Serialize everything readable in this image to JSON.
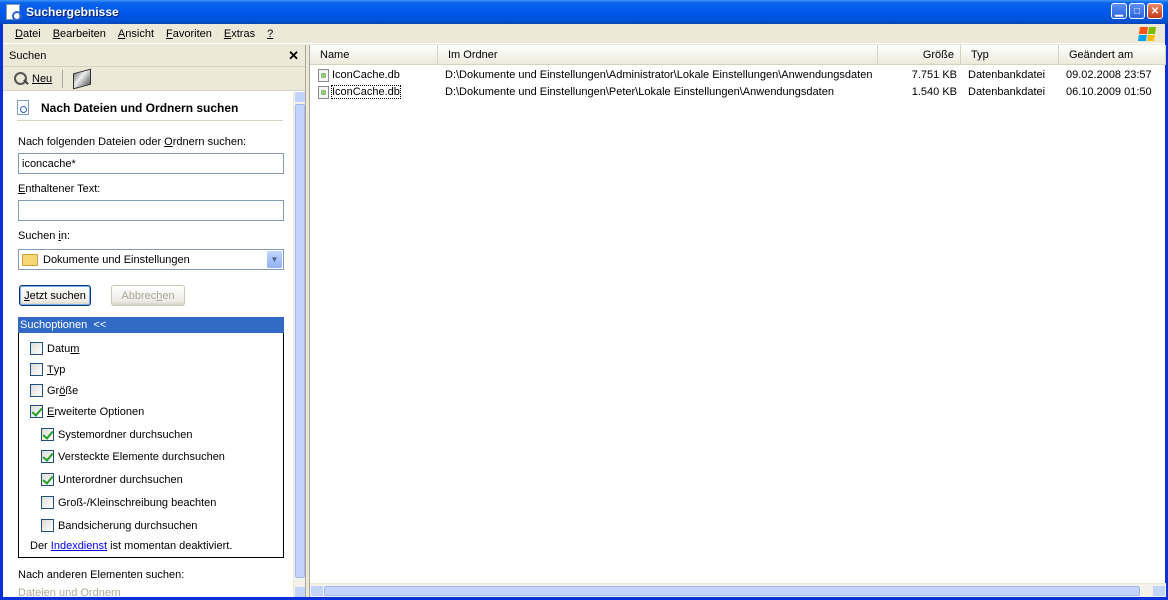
{
  "window": {
    "title": "Suchergebnisse",
    "controls": [
      "minimize",
      "maximize",
      "close"
    ]
  },
  "menu": {
    "items": [
      {
        "pre": "",
        "key": "D",
        "post": "atei"
      },
      {
        "pre": "",
        "key": "B",
        "post": "earbeiten"
      },
      {
        "pre": "",
        "key": "A",
        "post": "nsicht"
      },
      {
        "pre": "",
        "key": "F",
        "post": "avoriten"
      },
      {
        "pre": "",
        "key": "E",
        "post": "xtras"
      },
      {
        "pre": "",
        "key": "?",
        "post": ""
      }
    ]
  },
  "search_pane": {
    "header": "Suchen",
    "close_glyph": "✕",
    "toolbar": {
      "new_label": "Neu"
    },
    "section_title": "Nach Dateien und Ordnern suchen",
    "filename_label": {
      "pre": "Nach folgenden Dateien oder ",
      "key": "O",
      "post": "rdnern suchen:"
    },
    "filename_value": "iconcache*",
    "contains_label": {
      "pre": "",
      "key": "E",
      "post": "nthaltener Text:"
    },
    "contains_value": "",
    "look_in_label": {
      "pre": "Suchen ",
      "key": "i",
      "post": "n:"
    },
    "look_in_value": "Dokumente und Einstellungen",
    "search_button": {
      "pre": "",
      "key": "J",
      "post": "etzt suchen"
    },
    "cancel_button": {
      "pre": "Abbrec",
      "key": "h",
      "post": "en"
    },
    "options_header": "Suchoptionen  <<",
    "options": [
      {
        "pre": "Datu",
        "key": "m",
        "post": "",
        "checked": false
      },
      {
        "pre": "",
        "key": "T",
        "post": "yp",
        "checked": false
      },
      {
        "pre": "Gr",
        "key": "ö",
        "post": "ße",
        "checked": false
      },
      {
        "pre": "",
        "key": "E",
        "post": "rweiterte Optionen",
        "checked": true
      }
    ],
    "advanced_options": [
      {
        "label": "Systemordner durchsuchen",
        "checked": true
      },
      {
        "label": "Versteckte Elemente durchsuchen",
        "checked": true
      },
      {
        "label": "Unterordner durchsuchen",
        "checked": true
      },
      {
        "label": "Groß-/Kleinschreibung beachten",
        "checked": false
      },
      {
        "label": "Bandsicherung durchsuchen",
        "checked": false
      }
    ],
    "index_note": {
      "pre": "Der ",
      "link": "Indexdienst",
      "post": " ist momentan deaktiviert."
    },
    "other_label": "Nach anderen Elementen suchen:",
    "other_link": "Dateien und Ordnern"
  },
  "results": {
    "columns": {
      "name": "Name",
      "folder": "Im Ordner",
      "size": "Größe",
      "type": "Typ",
      "modified": "Geändert am"
    },
    "rows": [
      {
        "name": "IconCache.db",
        "folder": "D:\\Dokumente und Einstellungen\\Administrator\\Lokale Einstellungen\\Anwendungsdaten",
        "size": "7.751 KB",
        "type": "Datenbankdatei",
        "modified": "09.02.2008 23:57"
      },
      {
        "name": "IconCache.db",
        "folder": "D:\\Dokumente und Einstellungen\\Peter\\Lokale Einstellungen\\Anwendungsdaten",
        "size": "1.540 KB",
        "type": "Datenbankdatei",
        "modified": "06.10.2009 01:50"
      }
    ]
  },
  "colors": {
    "titlebar": "#0058ee",
    "selection": "#316ac5",
    "link": "#0000ff",
    "winlogo": [
      "#f65314",
      "#7cbb00",
      "#00a1f1",
      "#ffbb00"
    ]
  }
}
